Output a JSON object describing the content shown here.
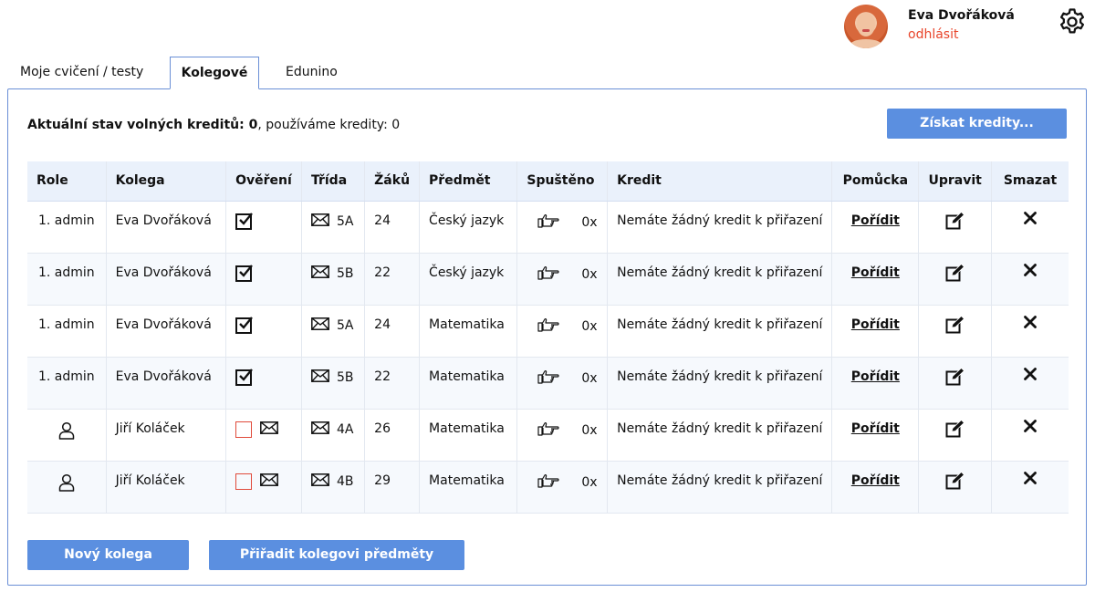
{
  "user": {
    "name": "Eva Dvořáková",
    "logout_label": "odhlásit"
  },
  "tabs": [
    {
      "label": "Moje cvičení / testy",
      "active": false
    },
    {
      "label": "Kolegové",
      "active": true
    },
    {
      "label": "Edunino",
      "active": false
    }
  ],
  "credits": {
    "label_bold": "Aktuální stav volných kreditů: 0",
    "label_rest": ", používáme kredity: 0",
    "get_button": "Získat kredity..."
  },
  "table": {
    "headers": [
      "Role",
      "Kolega",
      "Ověření",
      "Třída",
      "Žáků",
      "Předmět",
      "Spuštěno",
      "Kredit",
      "Pomůcka",
      "Upravit",
      "Smazat"
    ],
    "rows": [
      {
        "role": "1. admin",
        "role_icon": false,
        "kolega": "Eva Dvořáková",
        "verified": true,
        "trida": "5A",
        "zaku": "24",
        "predmet": "Český jazyk",
        "spusteno": "0x",
        "kredit": "Nemáte žádný kredit k přiřazení",
        "pomucka": "Pořídit"
      },
      {
        "role": "1. admin",
        "role_icon": false,
        "kolega": "Eva Dvořáková",
        "verified": true,
        "trida": "5B",
        "zaku": "22",
        "predmet": "Český jazyk",
        "spusteno": "0x",
        "kredit": "Nemáte žádný kredit k přiřazení",
        "pomucka": "Pořídit"
      },
      {
        "role": "1. admin",
        "role_icon": false,
        "kolega": "Eva Dvořáková",
        "verified": true,
        "trida": "5A",
        "zaku": "24",
        "predmet": "Matematika",
        "spusteno": "0x",
        "kredit": "Nemáte žádný kredit k přiřazení",
        "pomucka": "Pořídit"
      },
      {
        "role": "1. admin",
        "role_icon": false,
        "kolega": "Eva Dvořáková",
        "verified": true,
        "trida": "5B",
        "zaku": "22",
        "predmet": "Matematika",
        "spusteno": "0x",
        "kredit": "Nemáte žádný kredit k přiřazení",
        "pomucka": "Pořídit"
      },
      {
        "role": "",
        "role_icon": true,
        "kolega": "Jiří Koláček",
        "verified": false,
        "trida": "4A",
        "zaku": "26",
        "predmet": "Matematika",
        "spusteno": "0x",
        "kredit": "Nemáte žádný kredit k přiřazení",
        "pomucka": "Pořídit"
      },
      {
        "role": "",
        "role_icon": true,
        "kolega": "Jiří Koláček",
        "verified": false,
        "trida": "4B",
        "zaku": "29",
        "predmet": "Matematika",
        "spusteno": "0x",
        "kredit": "Nemáte žádný kredit k přiřazení",
        "pomucka": "Pořídit"
      }
    ]
  },
  "buttons": {
    "new_colleague": "Nový kolega",
    "assign_subjects": "Přiřadit kolegovi předměty"
  },
  "colors": {
    "accent": "#5b8fe0",
    "logout": "#e8442a",
    "header_bg": "#eaf1fb",
    "unverified": "#e04a3a"
  },
  "icons": {
    "gear": "gear-icon",
    "envelope": "envelope-icon",
    "pointing_hand": "pointing-hand-icon",
    "edit": "edit-icon",
    "delete": "close-icon",
    "user": "user-icon",
    "checkbox": "checkbox-checked-icon"
  }
}
